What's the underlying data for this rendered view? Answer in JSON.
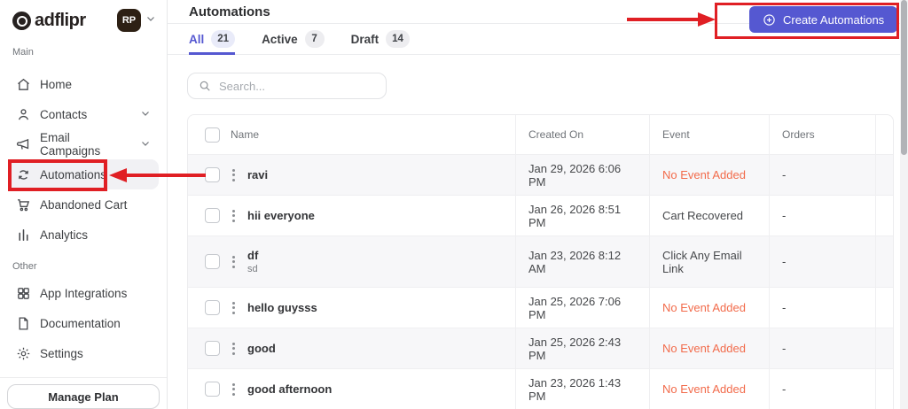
{
  "brand": {
    "logo_text": "adflipr",
    "avatar_initials": "RP"
  },
  "sidebar": {
    "section_main_label": "Main",
    "section_other_label": "Other",
    "items_main": [
      {
        "label": "Home"
      },
      {
        "label": "Contacts"
      },
      {
        "label": "Email Campaigns"
      },
      {
        "label": "Automations"
      },
      {
        "label": "Abandoned Cart"
      },
      {
        "label": "Analytics"
      }
    ],
    "items_other": [
      {
        "label": "App Integrations"
      },
      {
        "label": "Documentation"
      },
      {
        "label": "Settings"
      }
    ],
    "manage_plan_label": "Manage Plan"
  },
  "header": {
    "title": "Automations",
    "create_button_label": "Create Automations"
  },
  "tabs": [
    {
      "label": "All",
      "count": "21"
    },
    {
      "label": "Active",
      "count": "7"
    },
    {
      "label": "Draft",
      "count": "14"
    }
  ],
  "search": {
    "placeholder": "Search..."
  },
  "table": {
    "columns": {
      "name": "Name",
      "created": "Created On",
      "event": "Event",
      "orders": "Orders"
    },
    "rows": [
      {
        "name": "ravi",
        "created": "Jan 29, 2026 6:06 PM",
        "event": "No Event Added",
        "orders": "-"
      },
      {
        "name": "hii everyone",
        "created": "Jan 26, 2026 8:51 PM",
        "event": "Cart Recovered",
        "orders": "-"
      },
      {
        "name": "df",
        "subtitle": "sd",
        "created": "Jan 23, 2026 8:12 AM",
        "event": "Click Any Email Link",
        "orders": "-"
      },
      {
        "name": "hello guysss",
        "created": "Jan 25, 2026 7:06 PM",
        "event": "No Event Added",
        "orders": "-"
      },
      {
        "name": "good",
        "created": "Jan 25, 2026 2:43 PM",
        "event": "No Event Added",
        "orders": "-"
      },
      {
        "name": "good afternoon",
        "created": "Jan 23, 2026 1:43 PM",
        "event": "No Event Added",
        "orders": "-"
      }
    ]
  },
  "colors": {
    "accent": "#5558d1",
    "warning": "#f26b4b",
    "annotation_red": "#e01f24"
  }
}
